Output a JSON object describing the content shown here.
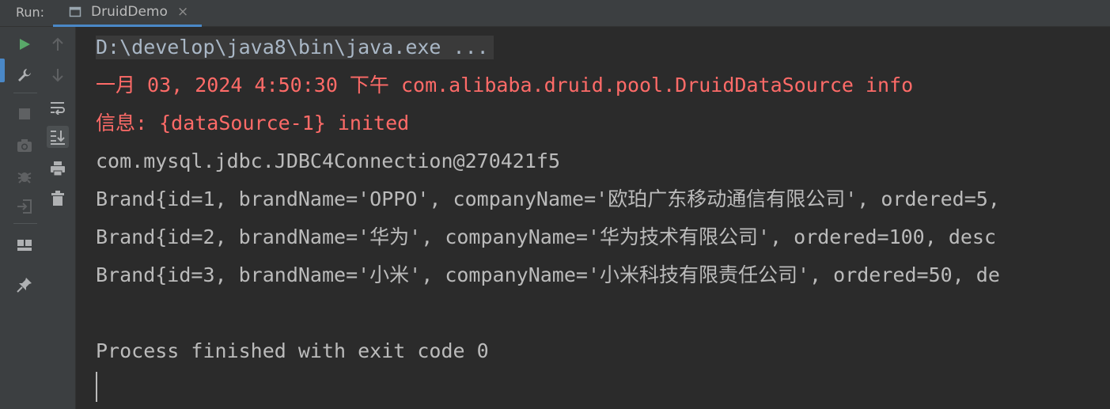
{
  "run_panel": {
    "label": "Run:",
    "tab_label": "DruidDemo",
    "tab_close": "×"
  },
  "toolbar": {
    "primary": [
      "run-icon",
      "wrench-icon",
      "stop-icon",
      "camera-icon",
      "debug-icon",
      "exit-icon",
      "layout-icon",
      "pin-icon"
    ],
    "secondary": [
      "arrow-up-icon",
      "arrow-down-icon",
      "soft-wrap-icon",
      "scroll-to-end-icon",
      "print-icon",
      "trash-icon"
    ]
  },
  "console": {
    "lines": [
      "D:\\develop\\java8\\bin\\java.exe ...",
      "一月 03, 2024 4:50:30 下午 com.alibaba.druid.pool.DruidDataSource info",
      "信息: {dataSource-1} inited",
      "com.mysql.jdbc.JDBC4Connection@270421f5",
      "Brand{id=1, brandName='OPPO', companyName='欧珀广东移动通信有限公司', ordered=5,",
      "Brand{id=2, brandName='华为', companyName='华为技术有限公司', ordered=100, desc",
      "Brand{id=3, brandName='小米', companyName='小米科技有限责任公司', ordered=50, de",
      "",
      "Process finished with exit code 0"
    ]
  },
  "colors": {
    "background": "#2b2b2b",
    "panel": "#3c3f41",
    "error_text": "#ff6b68",
    "normal_text": "#bbbbbb",
    "accent": "#4a88c7",
    "run_green": "#59a869"
  }
}
